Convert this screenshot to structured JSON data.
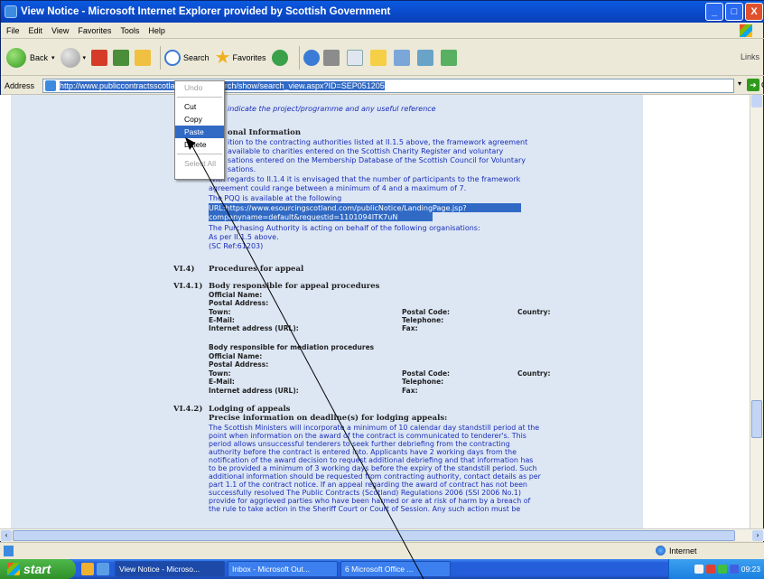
{
  "window": {
    "title": "View Notice - Microsoft Internet Explorer provided by Scottish Government",
    "btn_min": "_",
    "btn_max": "□",
    "btn_close": "X"
  },
  "menu": {
    "items": [
      "File",
      "Edit",
      "View",
      "Favorites",
      "Tools",
      "Help"
    ]
  },
  "toolbar": {
    "back": "Back",
    "search": "Search",
    "favorites": "Favorites",
    "links": "Links"
  },
  "address": {
    "label": "Address",
    "url": "http://www.publiccontractsscotland.gov.uk/search/show/search_view.aspx?ID=SEP051205",
    "go": "Go"
  },
  "context_menu": {
    "items": [
      "Undo",
      "Cut",
      "Copy",
      "Paste",
      "Delete",
      "Select All"
    ]
  },
  "document": {
    "line_top": "indicate the project/programme and any useful reference",
    "additional_heading": "onal Information",
    "additional_text": [
      "ition to the contracting authorities listed at II.1.5 above, the framework agreement",
      "available to charities entered on the Scottish Charity Register and voluntary",
      "sations entered on the Membership Database of the Scottish Council for Voluntary",
      "sations.",
      "With regards to II.1.4 it is envisaged that the number of participants to the framework",
      "agreement could range between a minimum of 4 and a maximum of 7.",
      "The PQQ is available at the following"
    ],
    "url_line1": "URL:https://www.esourcingscotland.com/publicNotice/LandingPage.jsp?",
    "url_line2": "companyname=default&requestid=1101094ITK7uN",
    "purchasing_text": [
      "The Purchasing Authority is acting on behalf of the following organisations:",
      "As per II.1.5 above.",
      "(SC Ref:61203)"
    ],
    "s_vi4_num": "VI.4)",
    "s_vi4_title": "Procedures for appeal",
    "s_vi41_num": "VI.4.1)",
    "s_vi41_title": "Body responsible for appeal procedures",
    "official_name": "Official Name:",
    "postal_address": "Postal Address:",
    "town": "Town:",
    "postal_code": "Postal Code:",
    "country": "Country:",
    "email_a": "E-Mail:",
    "telephone": "Telephone:",
    "internet": "Internet address (URL):",
    "fax": "Fax:",
    "mediation_title": "Body responsible for mediation procedures",
    "email_b": "E-Mail:",
    "s_vi42_num": "VI.4.2)",
    "s_vi42_title": "Lodging of appeals",
    "precise": "Precise information on deadline(s) for lodging appeals:",
    "appeal_text": [
      "The Scottish Ministers will incorporate a minimum of 10 calendar day standstill period at the",
      "point when information on the award of the contract is communicated to tenderer's. This",
      "period allows unsuccessful tenderers to seek further debriefing from the contracting",
      "authority before the contract is entered into. Applicants have 2 working days from the",
      "notification of the award decision to request additional debriefing and that information has",
      "to be provided a minimum of 3 working days before the expiry of the standstill period. Such",
      "additional information should be requested from contracting authority, contact details as per",
      "part 1.1 of the contract notice. If an appeal regarding the award of contract has not been",
      "successfully resolved The Public Contracts (Scotland) Regulations 2006 (SSI 2006 No.1)",
      "provide for aggrieved parties who have been harmed or are at risk of harm by a breach of",
      "the rule to take action in the Sheriff Court or Court of Session. Any such action must be"
    ]
  },
  "status": {
    "zone": "Internet"
  },
  "taskbar": {
    "start": "start",
    "tasks": [
      "View Notice - Microso...",
      "Inbox - Microsoft Out...",
      "6 Microsoft Office ..."
    ],
    "clock": "09:23"
  }
}
